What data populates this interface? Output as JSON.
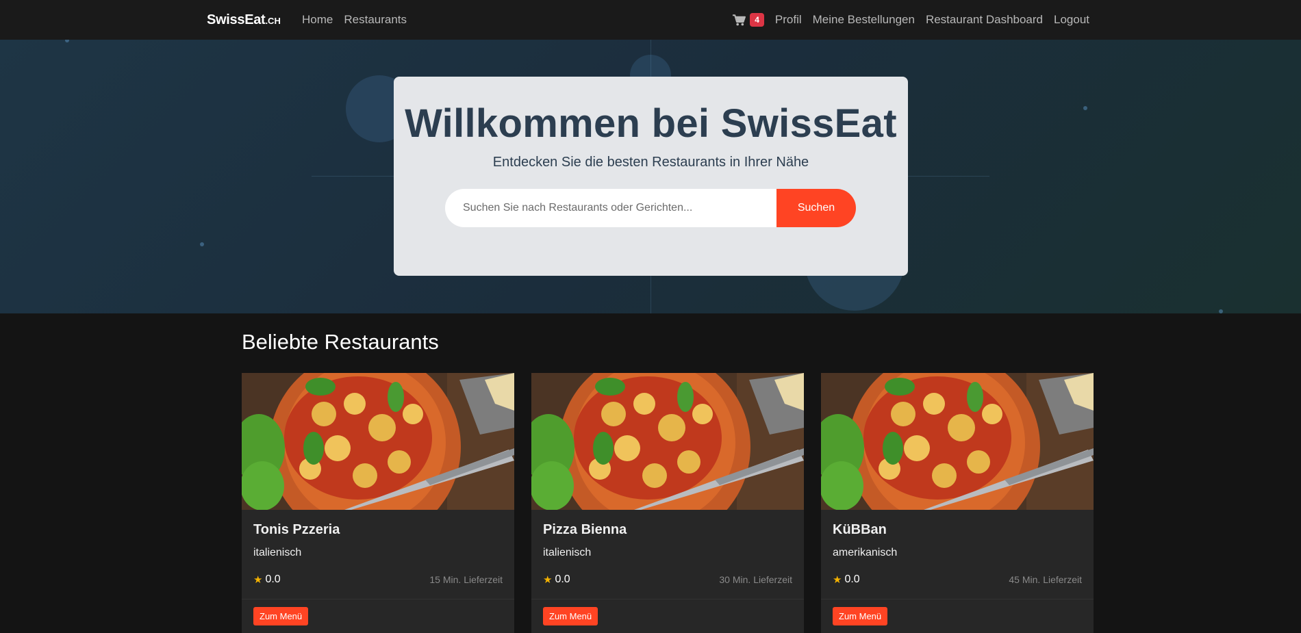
{
  "navbar": {
    "brand": "SwissEat",
    "brand_tld": ".CH",
    "left_links": [
      {
        "label": "Home"
      },
      {
        "label": "Restaurants"
      }
    ],
    "cart_count": "4",
    "right_links": [
      {
        "label": "Profil"
      },
      {
        "label": "Meine Bestellungen"
      },
      {
        "label": "Restaurant Dashboard"
      },
      {
        "label": "Logout"
      }
    ]
  },
  "hero": {
    "title": "Willkommen bei SwissEat",
    "subtitle": "Entdecken Sie die besten Restaurants in Ihrer Nähe",
    "search_placeholder": "Suchen Sie nach Restaurants oder Gerichten...",
    "search_value": "",
    "search_button": "Suchen"
  },
  "section": {
    "title": "Beliebte Restaurants"
  },
  "restaurants": [
    {
      "name": "Tonis Pzzeria",
      "cuisine": "italienisch",
      "rating": "0.0",
      "eta": "15 Min. Lieferzeit",
      "button": "Zum Menü"
    },
    {
      "name": "Pizza Bienna",
      "cuisine": "italienisch",
      "rating": "0.0",
      "eta": "30 Min. Lieferzeit",
      "button": "Zum Menü"
    },
    {
      "name": "KüBBan",
      "cuisine": "amerikanisch",
      "rating": "0.0",
      "eta": "45 Min. Lieferzeit",
      "button": "Zum Menü"
    }
  ],
  "icons": {
    "cart": "shopping-cart-icon",
    "star": "star-icon"
  },
  "colors": {
    "accent": "#ff4423",
    "badge": "#dc3545",
    "star": "#f5b301",
    "hero_title": "#2c3e50"
  }
}
